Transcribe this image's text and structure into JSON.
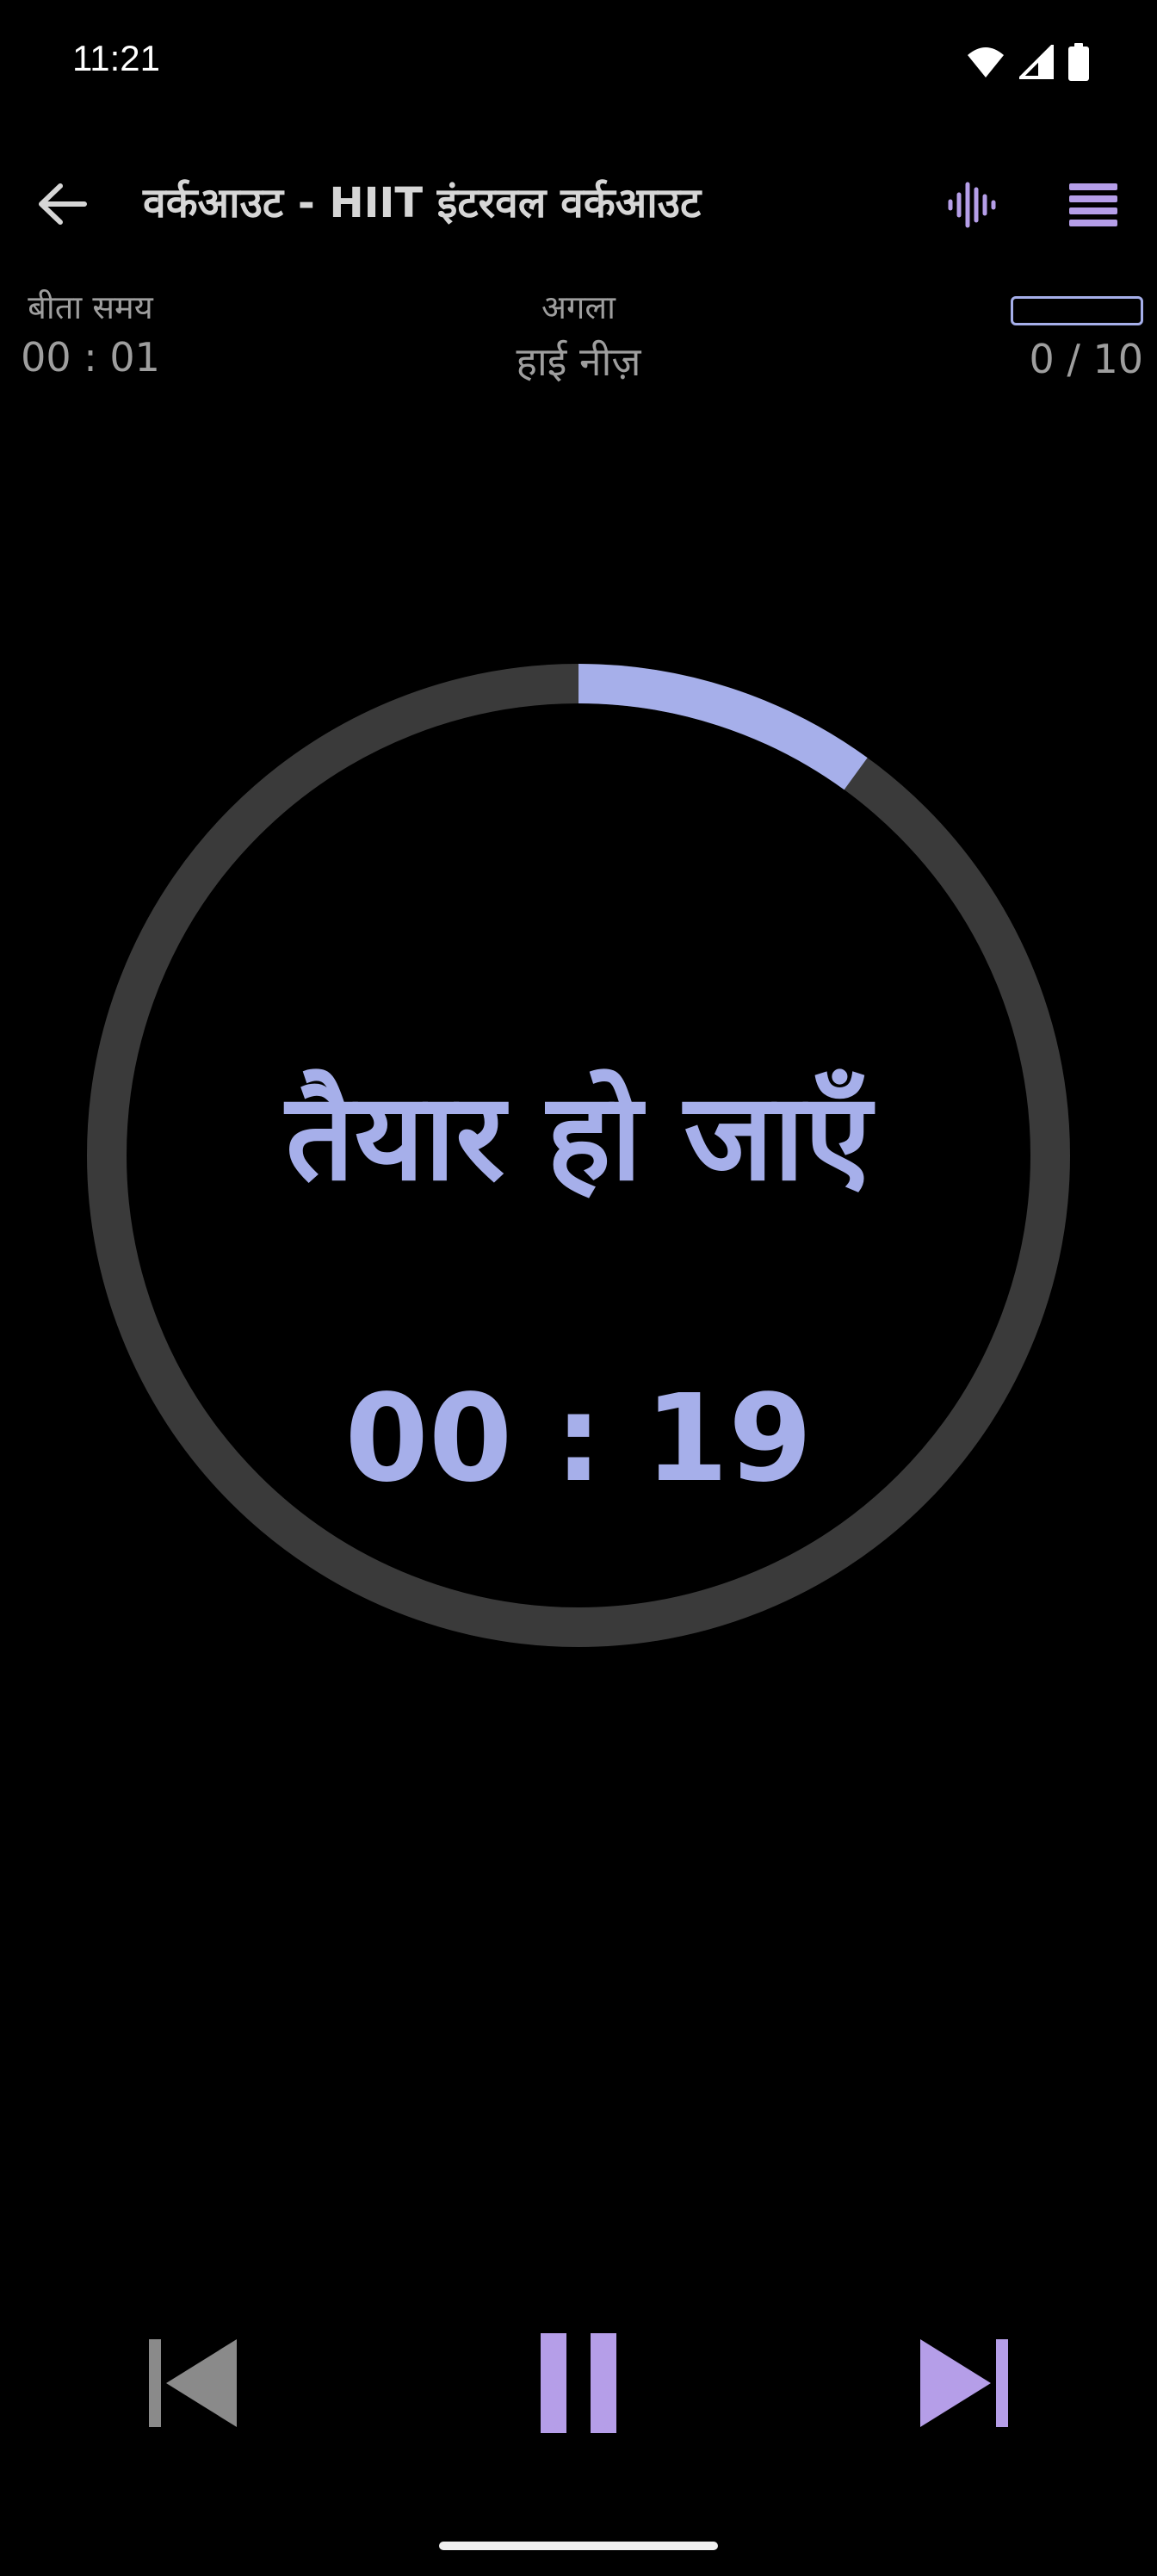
{
  "status_bar": {
    "time": "11:21",
    "icons": [
      "wifi-icon",
      "cellular-signal-icon",
      "battery-icon"
    ]
  },
  "toolbar": {
    "back_icon": "arrow-left-icon",
    "title": "वर्कआउट - HIIT इंटरवल वर्कआउट",
    "voice_icon": "sound-wave-icon",
    "menu_icon": "list-icon"
  },
  "info": {
    "elapsed_label": "बीता समय",
    "elapsed_value": "00 : 01",
    "next_label": "अगला",
    "next_value": "हाई नीज़",
    "progress_text": "0 / 10",
    "progress_fraction": 0
  },
  "timer": {
    "phase": "तैयार हो जाएँ",
    "remaining": "00 : 19",
    "ring_progress_fraction": 0.1
  },
  "controls": {
    "previous_icon": "skip-previous-icon",
    "pause_icon": "pause-icon",
    "next_icon": "skip-next-icon"
  },
  "colors": {
    "accent": "#a6afea",
    "accent_purple": "#b59ee8",
    "ring_track": "#3a3a3a",
    "disabled": "#8a8a8a",
    "background": "#000000"
  }
}
